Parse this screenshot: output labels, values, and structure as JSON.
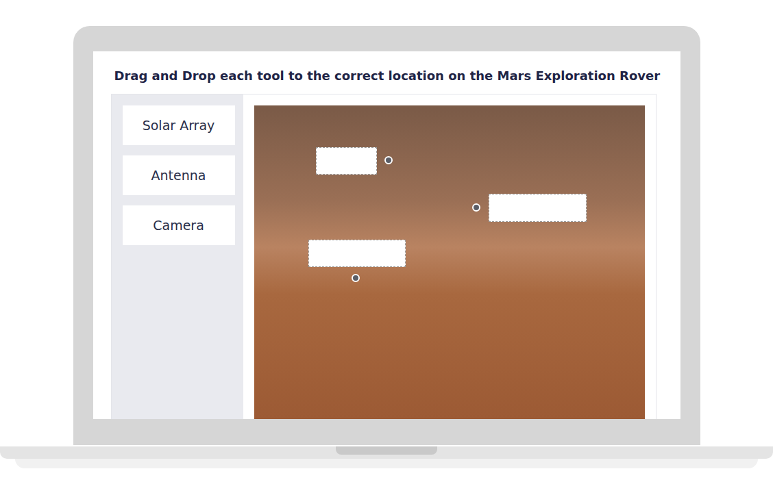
{
  "quiz": {
    "title": "Drag and Drop each tool to the correct location on the Mars Exploration Rover"
  },
  "tools": [
    {
      "label": "Solar Array"
    },
    {
      "label": "Antenna"
    },
    {
      "label": "Camera"
    }
  ],
  "drop_zones": [
    {
      "filled": false
    },
    {
      "filled": false
    },
    {
      "filled": false
    }
  ]
}
